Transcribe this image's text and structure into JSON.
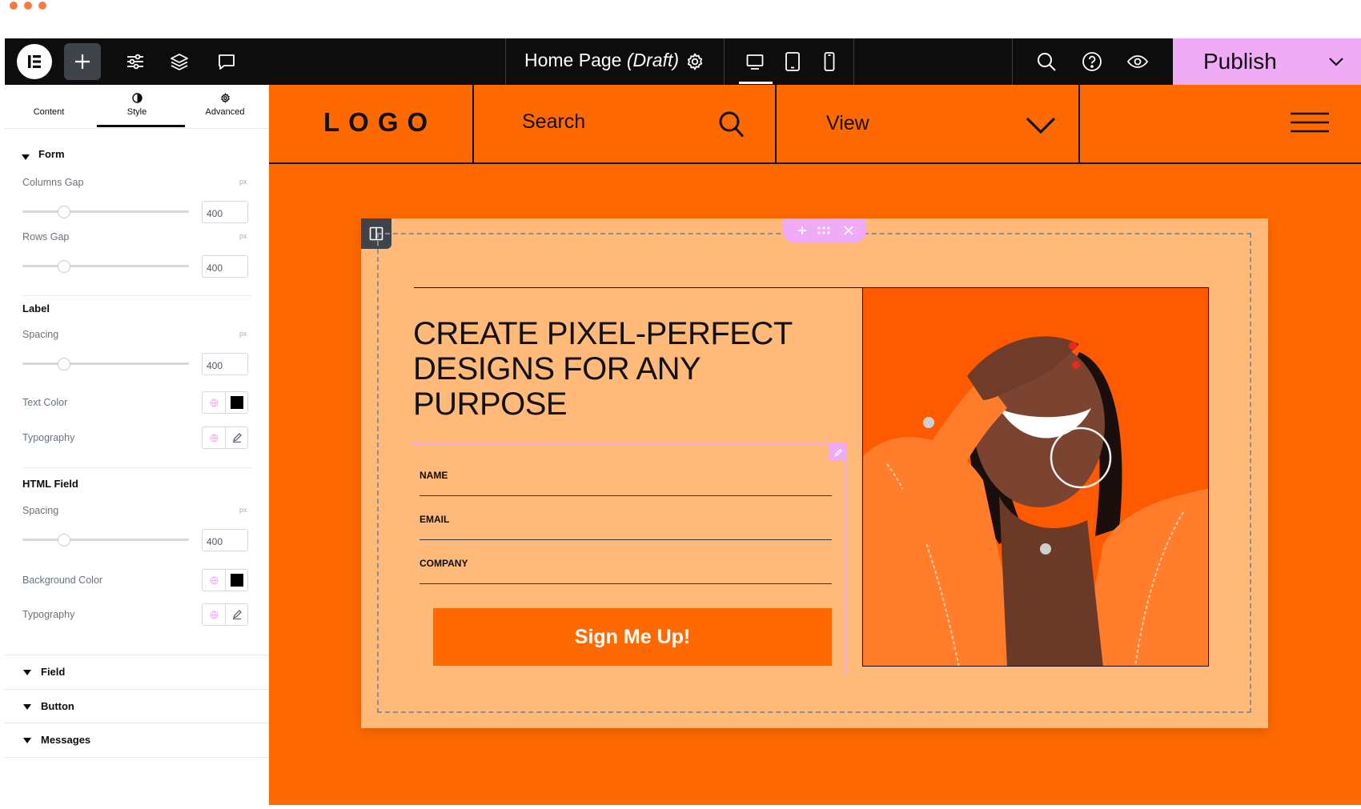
{
  "colors": {
    "accent": "#ff6a00",
    "publish": "#f0abf7",
    "card": "#ffba7a",
    "topbar": "#0d0d0d"
  },
  "topbar": {
    "page_title": "Home Page",
    "page_status": "(Draft)",
    "publish_label": "Publish",
    "icons": [
      "elementor-logo-icon",
      "plus-icon",
      "sliders-icon",
      "layers-icon",
      "comment-icon",
      "gear-icon",
      "desktop-icon",
      "tablet-icon",
      "mobile-icon",
      "search-icon",
      "help-icon",
      "eye-icon",
      "chevron-down-icon"
    ]
  },
  "panel": {
    "tabs": [
      {
        "label": "Content"
      },
      {
        "label": "Style"
      },
      {
        "label": "Advanced"
      }
    ],
    "form": {
      "title": "Form",
      "columns_gap": {
        "label": "Columns Gap",
        "unit": "px",
        "value": "400"
      },
      "rows_gap": {
        "label": "Rows Gap",
        "unit": "px",
        "value": "400"
      }
    },
    "label_section": {
      "title": "Label",
      "spacing": {
        "label": "Spacing",
        "unit": "px",
        "value": "400"
      },
      "text_color": {
        "label": "Text Color",
        "swatch": "#000000"
      },
      "typography": {
        "label": "Typography"
      }
    },
    "html_field": {
      "title": "HTML Field",
      "spacing": {
        "label": "Spacing",
        "unit": "px",
        "value": "400"
      },
      "background_color": {
        "label": "Background Color",
        "swatch": "#000000"
      },
      "typography": {
        "label": "Typography"
      }
    },
    "accordions": [
      {
        "label": "Field"
      },
      {
        "label": "Button"
      },
      {
        "label": "Messages"
      }
    ]
  },
  "site": {
    "logo": "LOGO",
    "search_label": "Search",
    "view_label": "View",
    "headline": [
      "CREATE PIXEL-PERFECT",
      "DESIGNS FOR ANY",
      "PURPOSE"
    ],
    "form_fields": [
      {
        "label": "NAME"
      },
      {
        "label": "EMAIL"
      },
      {
        "label": "COMPANY"
      }
    ],
    "button_label": "Sign Me Up!"
  }
}
